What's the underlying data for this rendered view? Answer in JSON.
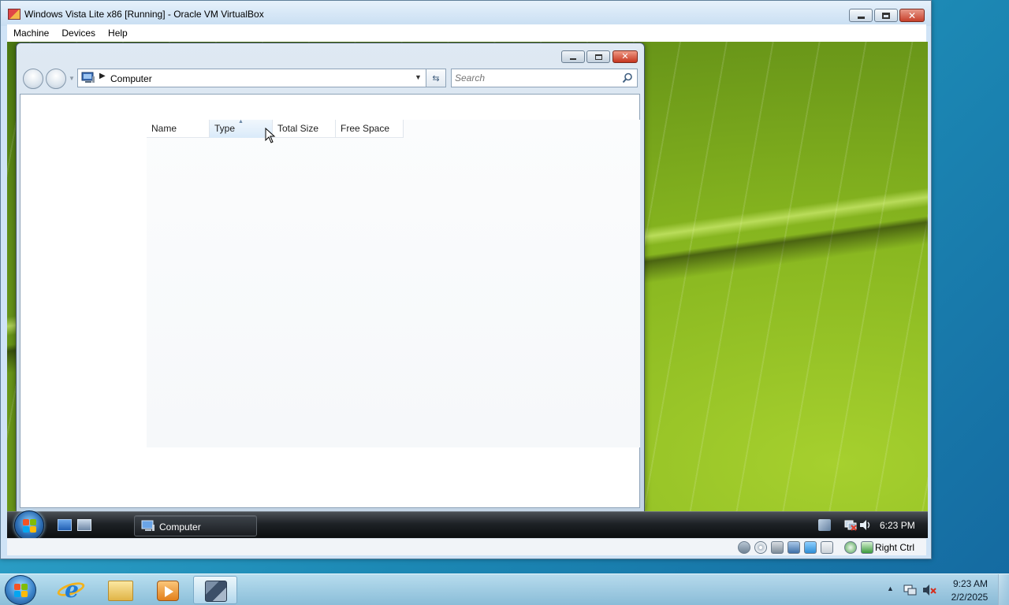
{
  "vbox": {
    "title": "Windows Vista Lite x86 [Running] - Oracle VM VirtualBox",
    "menu": [
      "Machine",
      "Devices",
      "Help"
    ],
    "host_key_label": "Right Ctrl"
  },
  "explorer": {
    "address": "Computer",
    "search_placeholder": "Search",
    "columns": [
      "Name",
      "Type",
      "Total Size",
      "Free Space"
    ],
    "sorted_column": "Type"
  },
  "guest_taskbar": {
    "active_task": "Computer",
    "clock": "6:23 PM"
  },
  "host_taskbar": {
    "pinned": [
      "internet-explorer",
      "windows-explorer",
      "windows-media-player",
      "virtualbox"
    ],
    "clock_time": "9:23 AM",
    "clock_date": "2/2/2025"
  },
  "colors": {
    "accent": "#2a9cc4",
    "wallpaper_leaf": "#86b51f",
    "close_button": "#c7402b"
  }
}
